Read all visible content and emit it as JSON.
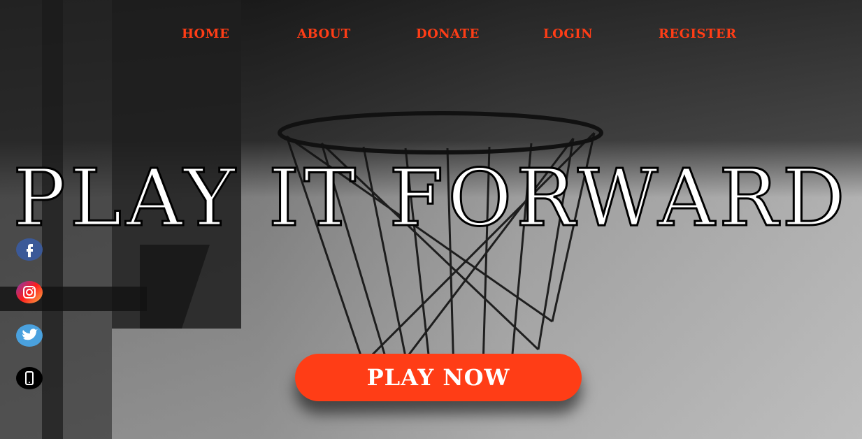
{
  "nav": {
    "home": "HOME",
    "about": "ABOUT",
    "donate": "DONATE",
    "login": "LOGIN",
    "register": "REGISTER"
  },
  "hero": {
    "headline": "PLAY IT FORWARD",
    "cta_label": "PLAY NOW"
  },
  "social": {
    "icons": [
      "facebook-icon",
      "instagram-icon",
      "twitter-icon",
      "phone-icon"
    ]
  },
  "colors": {
    "accent": "#ff3d16",
    "headline_fill": "#ffffff",
    "headline_stroke": "#000000"
  }
}
